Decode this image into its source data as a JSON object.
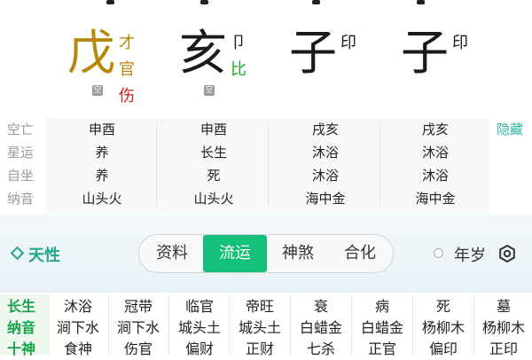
{
  "pillars": [
    {
      "stem": "戊",
      "stem_color": "#b8860b",
      "gods": [
        "才",
        "官"
      ],
      "extra": "伤",
      "extra_color": "#d41e1e",
      "kong": "空"
    },
    {
      "stem": "亥",
      "stem_color": "#111111",
      "gods": [
        "卩"
      ],
      "extra": "比",
      "extra_color": "#1eaa2d",
      "kong": "空"
    },
    {
      "stem": "子",
      "stem_color": "#111111",
      "gods": [
        "印"
      ]
    },
    {
      "stem": "子",
      "stem_color": "#111111",
      "gods": [
        "印"
      ]
    }
  ],
  "info": {
    "labels": [
      "空亡",
      "星运",
      "自坐",
      "纳音"
    ],
    "columns": [
      [
        "申酉",
        "养",
        "养",
        "山头火"
      ],
      [
        "申酉",
        "长生",
        "死",
        "山头火"
      ],
      [
        "戌亥",
        "沐浴",
        "沐浴",
        "海中金"
      ],
      [
        "戌亥",
        "沐浴",
        "沐浴",
        "海中金"
      ]
    ],
    "hide_label": "隐藏"
  },
  "band": {
    "tianxing": "天性",
    "tabs": [
      "资料",
      "流运",
      "神煞",
      "合化"
    ],
    "active_tab": 1,
    "year_label": "年岁"
  },
  "grid": {
    "row_labels": [
      "长生",
      "纳音",
      "十神"
    ],
    "columns": [
      [
        "沐浴",
        "涧下水",
        "食神"
      ],
      [
        "冠带",
        "涧下水",
        "伤官"
      ],
      [
        "临官",
        "城头土",
        "偏财"
      ],
      [
        "帝旺",
        "城头土",
        "正财"
      ],
      [
        "衰",
        "白蜡金",
        "七杀"
      ],
      [
        "病",
        "白蜡金",
        "正官"
      ],
      [
        "死",
        "杨柳木",
        "偏印"
      ],
      [
        "墓",
        "杨柳木",
        "正印"
      ]
    ]
  },
  "colors": {
    "accent": "#13c07a",
    "label_green": "#16a34a",
    "link": "#2db7a3"
  }
}
